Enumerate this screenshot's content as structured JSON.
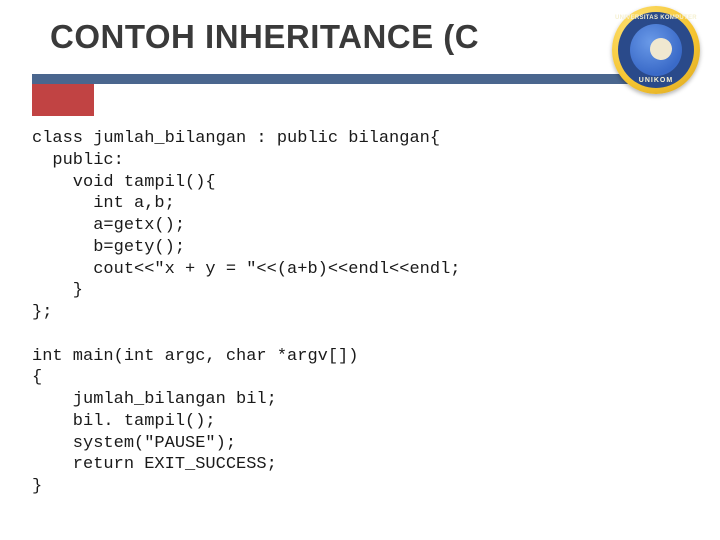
{
  "title": "CONTOH INHERITANCE (C",
  "logo": {
    "top_text": "UNIVERSITAS KOMPUTER",
    "bottom_text": "UNIKOM"
  },
  "code": "class jumlah_bilangan : public bilangan{\n  public:\n    void tampil(){\n      int a,b;\n      a=getx();\n      b=gety();\n      cout<<\"x + y = \"<<(a+b)<<endl<<endl;\n    }\n};\n\nint main(int argc, char *argv[])\n{\n    jumlah_bilangan bil;\n    bil. tampil();\n    system(\"PAUSE\");\n    return EXIT_SUCCESS;\n}"
}
